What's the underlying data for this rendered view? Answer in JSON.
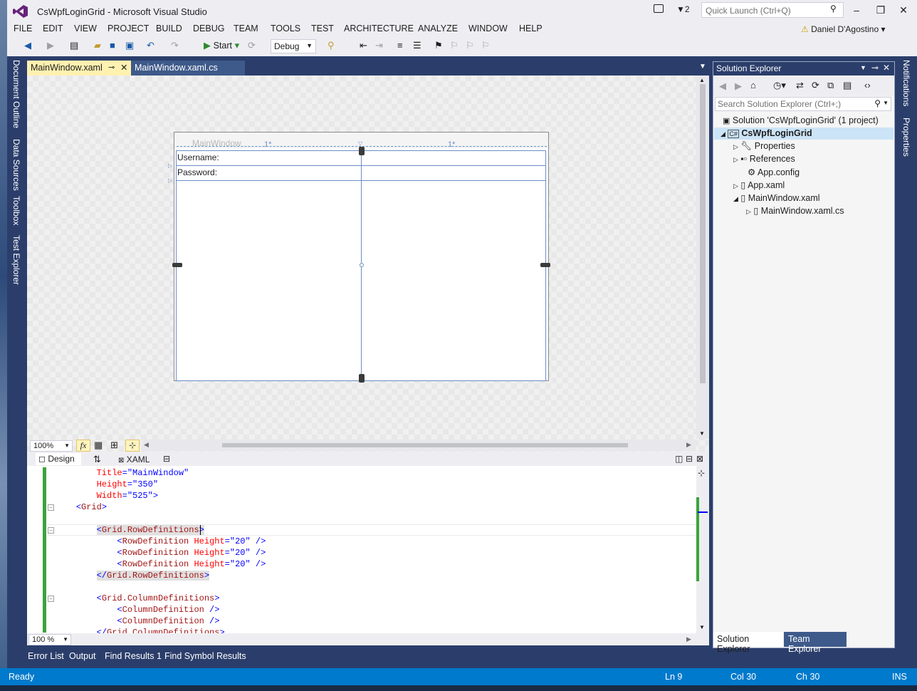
{
  "window": {
    "title": "CsWpfLoginGrid - Microsoft Visual Studio",
    "notification_count": "2",
    "quick_launch_placeholder": "Quick Launch (Ctrl+Q)"
  },
  "menu": [
    "FILE",
    "EDIT",
    "VIEW",
    "PROJECT",
    "BUILD",
    "DEBUG",
    "TEAM",
    "TOOLS",
    "TEST",
    "ARCHITECTURE",
    "ANALYZE",
    "WINDOW",
    "HELP"
  ],
  "user": {
    "name": "Daniel D'Agostino"
  },
  "toolbar": {
    "start_label": "Start",
    "config": "Debug"
  },
  "left_rail": [
    "Document Outline",
    "Data Sources",
    "Toolbox",
    "Test Explorer"
  ],
  "right_rail": [
    "Notifications",
    "Properties"
  ],
  "tabs": [
    {
      "label": "MainWindow.xaml",
      "active": true
    },
    {
      "label": "MainWindow.xaml.cs",
      "active": false
    }
  ],
  "designer": {
    "zoom": "100%",
    "window_title": "MainWindow",
    "column_sizes": [
      "1*",
      "1*"
    ],
    "labels": {
      "username": "Username:",
      "password": "Password:"
    }
  },
  "split": {
    "design_label": "Design",
    "xaml_label": "XAML"
  },
  "code": {
    "zoom": "100 %",
    "lines": [
      {
        "indent": "        ",
        "parts": [
          [
            "a",
            "Title"
          ],
          [
            "p",
            "="
          ],
          [
            "s",
            "\"MainWindow\""
          ]
        ]
      },
      {
        "indent": "        ",
        "parts": [
          [
            "a",
            "Height"
          ],
          [
            "p",
            "="
          ],
          [
            "s",
            "\"350\""
          ]
        ]
      },
      {
        "indent": "        ",
        "parts": [
          [
            "a",
            "Width"
          ],
          [
            "p",
            "="
          ],
          [
            "s",
            "\"525\""
          ],
          [
            "p",
            ">"
          ]
        ]
      },
      {
        "indent": "    ",
        "parts": [
          [
            "p",
            "<"
          ],
          [
            "t",
            "Grid"
          ],
          [
            "p",
            ">"
          ]
        ]
      },
      {
        "indent": "",
        "parts": []
      },
      {
        "indent": "        ",
        "parts": [
          [
            "p",
            "<"
          ],
          [
            "t",
            "Grid.RowDefinitions"
          ],
          [
            "p",
            ">"
          ]
        ]
      },
      {
        "indent": "            ",
        "parts": [
          [
            "p",
            "<"
          ],
          [
            "t",
            "RowDefinition"
          ],
          [
            "p",
            " "
          ],
          [
            "a",
            "Height"
          ],
          [
            "p",
            "="
          ],
          [
            "s",
            "\"20\""
          ],
          [
            "p",
            " />"
          ]
        ]
      },
      {
        "indent": "            ",
        "parts": [
          [
            "p",
            "<"
          ],
          [
            "t",
            "RowDefinition"
          ],
          [
            "p",
            " "
          ],
          [
            "a",
            "Height"
          ],
          [
            "p",
            "="
          ],
          [
            "s",
            "\"20\""
          ],
          [
            "p",
            " />"
          ]
        ]
      },
      {
        "indent": "            ",
        "parts": [
          [
            "p",
            "<"
          ],
          [
            "t",
            "RowDefinition"
          ],
          [
            "p",
            " "
          ],
          [
            "a",
            "Height"
          ],
          [
            "p",
            "="
          ],
          [
            "s",
            "\"20\""
          ],
          [
            "p",
            " />"
          ]
        ]
      },
      {
        "indent": "        ",
        "parts": [
          [
            "p",
            "</"
          ],
          [
            "t",
            "Grid.RowDefinitions"
          ],
          [
            "p",
            ">"
          ]
        ]
      },
      {
        "indent": "",
        "parts": []
      },
      {
        "indent": "        ",
        "parts": [
          [
            "p",
            "<"
          ],
          [
            "t",
            "Grid.ColumnDefinitions"
          ],
          [
            "p",
            ">"
          ]
        ]
      },
      {
        "indent": "            ",
        "parts": [
          [
            "p",
            "<"
          ],
          [
            "t",
            "ColumnDefinition"
          ],
          [
            "p",
            " />"
          ]
        ]
      },
      {
        "indent": "            ",
        "parts": [
          [
            "p",
            "<"
          ],
          [
            "t",
            "ColumnDefinition"
          ],
          [
            "p",
            " />"
          ]
        ]
      },
      {
        "indent": "        ",
        "parts": [
          [
            "p",
            "</"
          ],
          [
            "t",
            "Grid.ColumnDefinitions"
          ],
          [
            "p",
            ">"
          ]
        ]
      }
    ]
  },
  "bottom_tabs": [
    "Error List",
    "Output",
    "Find Results 1",
    "Find Symbol Results"
  ],
  "status": {
    "left": "Ready",
    "line": "Ln 9",
    "col": "Col 30",
    "ch": "Ch 30",
    "mode": "INS"
  },
  "solution_explorer": {
    "title": "Solution Explorer",
    "search_placeholder": "Search Solution Explorer (Ctrl+;)",
    "items": [
      {
        "label": "Solution 'CsWpfLoginGrid' (1 project)",
        "icon": "solution-icon"
      },
      {
        "label": "CsWpfLoginGrid",
        "icon": "csharp-project-icon"
      },
      {
        "label": "Properties",
        "icon": "wrench-icon"
      },
      {
        "label": "References",
        "icon": "references-icon"
      },
      {
        "label": "App.config",
        "icon": "config-file-icon"
      },
      {
        "label": "App.xaml",
        "icon": "xaml-file-icon"
      },
      {
        "label": "MainWindow.xaml",
        "icon": "xaml-file-icon"
      },
      {
        "label": "MainWindow.xaml.cs",
        "icon": "cs-file-icon"
      }
    ],
    "tabs": [
      "Solution Explorer",
      "Team Explorer"
    ]
  },
  "colors": {
    "accent": "#007acc",
    "chrome": "#eeeef2",
    "dark": "#2b3e6b",
    "active_tab": "#fff1b0"
  }
}
